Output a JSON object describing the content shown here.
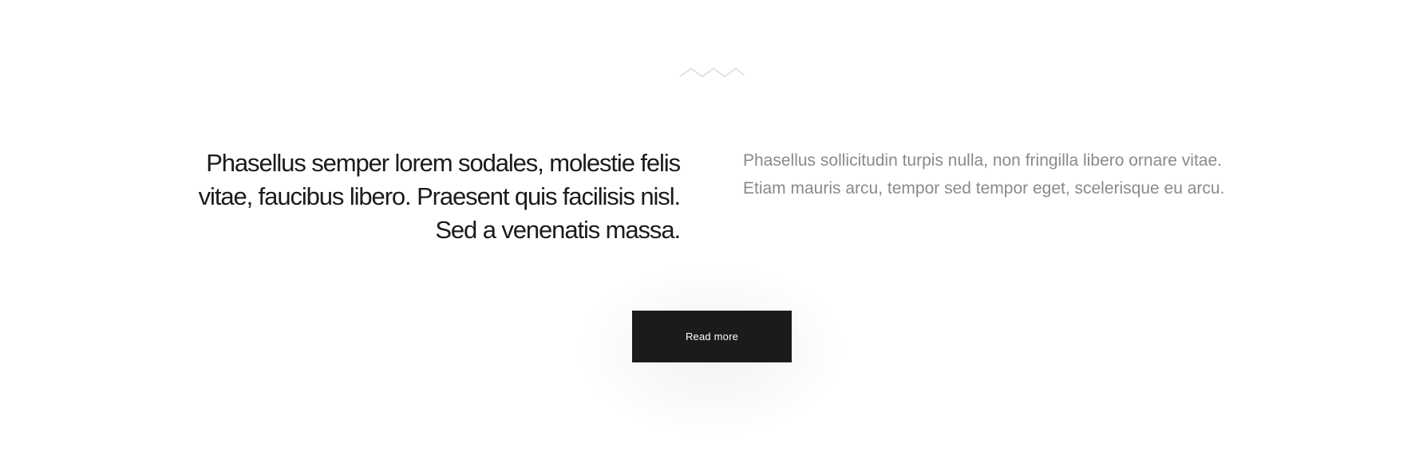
{
  "headline": "Phasellus semper lorem sodales, molestie felis vitae, faucibus libero. Praesent quis facilisis nisl. Sed a venenatis massa.",
  "body": "Phasellus sollicitudin turpis nulla, non fringilla libero ornare vitae. Etiam mauris arcu, tempor sed tempor eget, scelerisque eu arcu.",
  "cta": {
    "label": "Read more"
  },
  "ornament": {
    "icon": "zigzag-divider-icon",
    "color": "#e2e2e2"
  },
  "colors": {
    "headline": "#1b1b1b",
    "body": "#8a8a8a",
    "button_bg": "#1b1b1b",
    "button_text": "#ffffff",
    "background": "#ffffff"
  }
}
